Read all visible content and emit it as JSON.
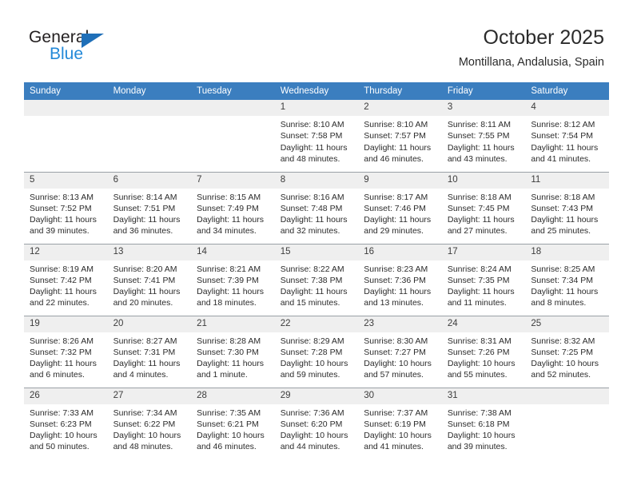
{
  "brand": {
    "name_line1": "General",
    "name_line2": "Blue",
    "color_dark": "#231f20",
    "color_blue": "#2389d8",
    "triangle_color": "#1f6fb8"
  },
  "header": {
    "title": "October 2025",
    "subtitle": "Montillana, Andalusia, Spain"
  },
  "theme": {
    "header_row_bg": "#3b7ebf",
    "header_row_text": "#ffffff",
    "daynum_bg": "#efefef",
    "grid_line": "#9aa0a6",
    "body_text": "#2b2b2b"
  },
  "weekdays": [
    "Sunday",
    "Monday",
    "Tuesday",
    "Wednesday",
    "Thursday",
    "Friday",
    "Saturday"
  ],
  "weeks": [
    [
      {
        "day": "",
        "sunrise": "",
        "sunset": "",
        "daylight_line1": "",
        "daylight_line2": ""
      },
      {
        "day": "",
        "sunrise": "",
        "sunset": "",
        "daylight_line1": "",
        "daylight_line2": ""
      },
      {
        "day": "",
        "sunrise": "",
        "sunset": "",
        "daylight_line1": "",
        "daylight_line2": ""
      },
      {
        "day": "1",
        "sunrise": "Sunrise: 8:10 AM",
        "sunset": "Sunset: 7:58 PM",
        "daylight_line1": "Daylight: 11 hours",
        "daylight_line2": "and 48 minutes."
      },
      {
        "day": "2",
        "sunrise": "Sunrise: 8:10 AM",
        "sunset": "Sunset: 7:57 PM",
        "daylight_line1": "Daylight: 11 hours",
        "daylight_line2": "and 46 minutes."
      },
      {
        "day": "3",
        "sunrise": "Sunrise: 8:11 AM",
        "sunset": "Sunset: 7:55 PM",
        "daylight_line1": "Daylight: 11 hours",
        "daylight_line2": "and 43 minutes."
      },
      {
        "day": "4",
        "sunrise": "Sunrise: 8:12 AM",
        "sunset": "Sunset: 7:54 PM",
        "daylight_line1": "Daylight: 11 hours",
        "daylight_line2": "and 41 minutes."
      }
    ],
    [
      {
        "day": "5",
        "sunrise": "Sunrise: 8:13 AM",
        "sunset": "Sunset: 7:52 PM",
        "daylight_line1": "Daylight: 11 hours",
        "daylight_line2": "and 39 minutes."
      },
      {
        "day": "6",
        "sunrise": "Sunrise: 8:14 AM",
        "sunset": "Sunset: 7:51 PM",
        "daylight_line1": "Daylight: 11 hours",
        "daylight_line2": "and 36 minutes."
      },
      {
        "day": "7",
        "sunrise": "Sunrise: 8:15 AM",
        "sunset": "Sunset: 7:49 PM",
        "daylight_line1": "Daylight: 11 hours",
        "daylight_line2": "and 34 minutes."
      },
      {
        "day": "8",
        "sunrise": "Sunrise: 8:16 AM",
        "sunset": "Sunset: 7:48 PM",
        "daylight_line1": "Daylight: 11 hours",
        "daylight_line2": "and 32 minutes."
      },
      {
        "day": "9",
        "sunrise": "Sunrise: 8:17 AM",
        "sunset": "Sunset: 7:46 PM",
        "daylight_line1": "Daylight: 11 hours",
        "daylight_line2": "and 29 minutes."
      },
      {
        "day": "10",
        "sunrise": "Sunrise: 8:18 AM",
        "sunset": "Sunset: 7:45 PM",
        "daylight_line1": "Daylight: 11 hours",
        "daylight_line2": "and 27 minutes."
      },
      {
        "day": "11",
        "sunrise": "Sunrise: 8:18 AM",
        "sunset": "Sunset: 7:43 PM",
        "daylight_line1": "Daylight: 11 hours",
        "daylight_line2": "and 25 minutes."
      }
    ],
    [
      {
        "day": "12",
        "sunrise": "Sunrise: 8:19 AM",
        "sunset": "Sunset: 7:42 PM",
        "daylight_line1": "Daylight: 11 hours",
        "daylight_line2": "and 22 minutes."
      },
      {
        "day": "13",
        "sunrise": "Sunrise: 8:20 AM",
        "sunset": "Sunset: 7:41 PM",
        "daylight_line1": "Daylight: 11 hours",
        "daylight_line2": "and 20 minutes."
      },
      {
        "day": "14",
        "sunrise": "Sunrise: 8:21 AM",
        "sunset": "Sunset: 7:39 PM",
        "daylight_line1": "Daylight: 11 hours",
        "daylight_line2": "and 18 minutes."
      },
      {
        "day": "15",
        "sunrise": "Sunrise: 8:22 AM",
        "sunset": "Sunset: 7:38 PM",
        "daylight_line1": "Daylight: 11 hours",
        "daylight_line2": "and 15 minutes."
      },
      {
        "day": "16",
        "sunrise": "Sunrise: 8:23 AM",
        "sunset": "Sunset: 7:36 PM",
        "daylight_line1": "Daylight: 11 hours",
        "daylight_line2": "and 13 minutes."
      },
      {
        "day": "17",
        "sunrise": "Sunrise: 8:24 AM",
        "sunset": "Sunset: 7:35 PM",
        "daylight_line1": "Daylight: 11 hours",
        "daylight_line2": "and 11 minutes."
      },
      {
        "day": "18",
        "sunrise": "Sunrise: 8:25 AM",
        "sunset": "Sunset: 7:34 PM",
        "daylight_line1": "Daylight: 11 hours",
        "daylight_line2": "and 8 minutes."
      }
    ],
    [
      {
        "day": "19",
        "sunrise": "Sunrise: 8:26 AM",
        "sunset": "Sunset: 7:32 PM",
        "daylight_line1": "Daylight: 11 hours",
        "daylight_line2": "and 6 minutes."
      },
      {
        "day": "20",
        "sunrise": "Sunrise: 8:27 AM",
        "sunset": "Sunset: 7:31 PM",
        "daylight_line1": "Daylight: 11 hours",
        "daylight_line2": "and 4 minutes."
      },
      {
        "day": "21",
        "sunrise": "Sunrise: 8:28 AM",
        "sunset": "Sunset: 7:30 PM",
        "daylight_line1": "Daylight: 11 hours",
        "daylight_line2": "and 1 minute."
      },
      {
        "day": "22",
        "sunrise": "Sunrise: 8:29 AM",
        "sunset": "Sunset: 7:28 PM",
        "daylight_line1": "Daylight: 10 hours",
        "daylight_line2": "and 59 minutes."
      },
      {
        "day": "23",
        "sunrise": "Sunrise: 8:30 AM",
        "sunset": "Sunset: 7:27 PM",
        "daylight_line1": "Daylight: 10 hours",
        "daylight_line2": "and 57 minutes."
      },
      {
        "day": "24",
        "sunrise": "Sunrise: 8:31 AM",
        "sunset": "Sunset: 7:26 PM",
        "daylight_line1": "Daylight: 10 hours",
        "daylight_line2": "and 55 minutes."
      },
      {
        "day": "25",
        "sunrise": "Sunrise: 8:32 AM",
        "sunset": "Sunset: 7:25 PM",
        "daylight_line1": "Daylight: 10 hours",
        "daylight_line2": "and 52 minutes."
      }
    ],
    [
      {
        "day": "26",
        "sunrise": "Sunrise: 7:33 AM",
        "sunset": "Sunset: 6:23 PM",
        "daylight_line1": "Daylight: 10 hours",
        "daylight_line2": "and 50 minutes."
      },
      {
        "day": "27",
        "sunrise": "Sunrise: 7:34 AM",
        "sunset": "Sunset: 6:22 PM",
        "daylight_line1": "Daylight: 10 hours",
        "daylight_line2": "and 48 minutes."
      },
      {
        "day": "28",
        "sunrise": "Sunrise: 7:35 AM",
        "sunset": "Sunset: 6:21 PM",
        "daylight_line1": "Daylight: 10 hours",
        "daylight_line2": "and 46 minutes."
      },
      {
        "day": "29",
        "sunrise": "Sunrise: 7:36 AM",
        "sunset": "Sunset: 6:20 PM",
        "daylight_line1": "Daylight: 10 hours",
        "daylight_line2": "and 44 minutes."
      },
      {
        "day": "30",
        "sunrise": "Sunrise: 7:37 AM",
        "sunset": "Sunset: 6:19 PM",
        "daylight_line1": "Daylight: 10 hours",
        "daylight_line2": "and 41 minutes."
      },
      {
        "day": "31",
        "sunrise": "Sunrise: 7:38 AM",
        "sunset": "Sunset: 6:18 PM",
        "daylight_line1": "Daylight: 10 hours",
        "daylight_line2": "and 39 minutes."
      },
      {
        "day": "",
        "sunrise": "",
        "sunset": "",
        "daylight_line1": "",
        "daylight_line2": ""
      }
    ]
  ]
}
